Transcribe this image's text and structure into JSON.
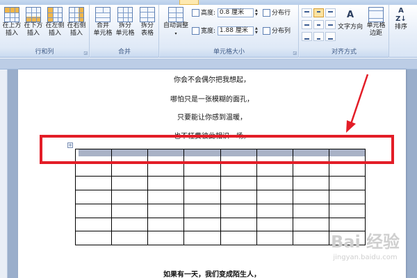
{
  "ribbon": {
    "groups": {
      "rows_cols": "行和列",
      "merge": "合并",
      "cell_size": "单元格大小",
      "alignment": "对齐方式"
    },
    "insert_above": [
      "在上方",
      "插入"
    ],
    "insert_below": [
      "在下方",
      "插入"
    ],
    "insert_left": [
      "在左侧",
      "插入"
    ],
    "insert_right": [
      "在右侧",
      "插入"
    ],
    "merge_cells": [
      "合并",
      "单元格"
    ],
    "split_cells": [
      "拆分",
      "单元格"
    ],
    "split_table": [
      "拆分",
      "表格"
    ],
    "autofit": "自动调整",
    "height_label": "高度:",
    "height_value": "0.8 厘米",
    "width_label": "宽度:",
    "width_value": "1.88 厘米",
    "distribute_rows": "分布行",
    "distribute_cols": "分布列",
    "text_direction": "文字方向",
    "cell_margins": [
      "单元格",
      "边距"
    ],
    "sort": "排序"
  },
  "document": {
    "lines": [
      "你会不会偶尔把我想起，",
      "哪怕只是一张模糊的面孔，",
      "只要能让你感到温暖，",
      "也不枉费彼此相识一场。"
    ],
    "bottom_line": "如果有一天，我们变成陌生人，"
  },
  "table": {
    "rows": 7,
    "cols": 8,
    "selected_row": 1
  },
  "watermark": {
    "logo": "Bai 经验",
    "url": "jingyan.baidu.com"
  },
  "colors": {
    "annotation": "#e31d27",
    "selection": "#a9b2c6"
  }
}
